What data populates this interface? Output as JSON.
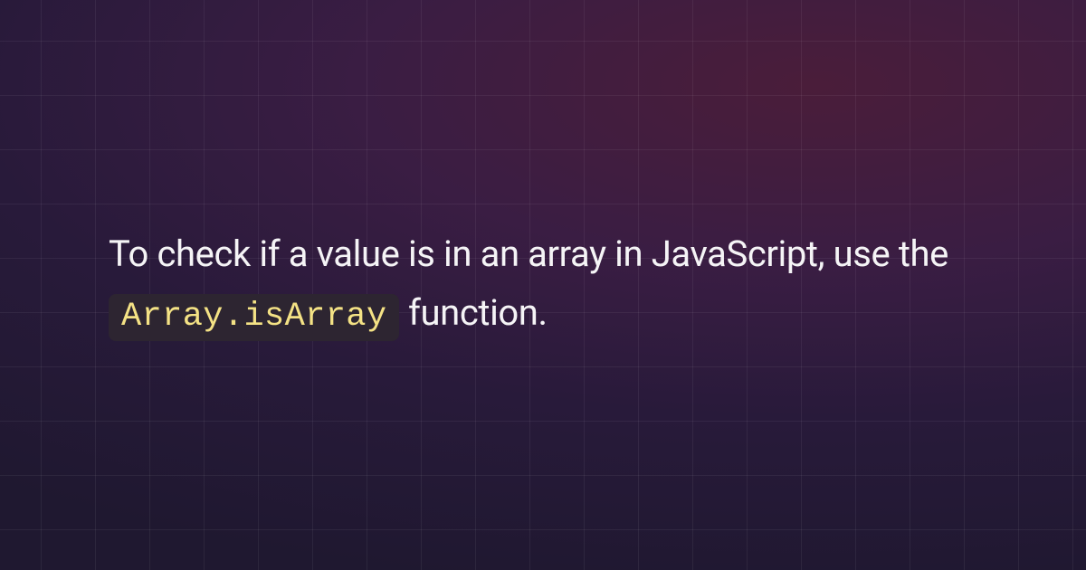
{
  "main": {
    "text_before": "To check if a value is in an array in JavaScript, use the ",
    "code": "Array.isArray",
    "text_after": " function."
  }
}
